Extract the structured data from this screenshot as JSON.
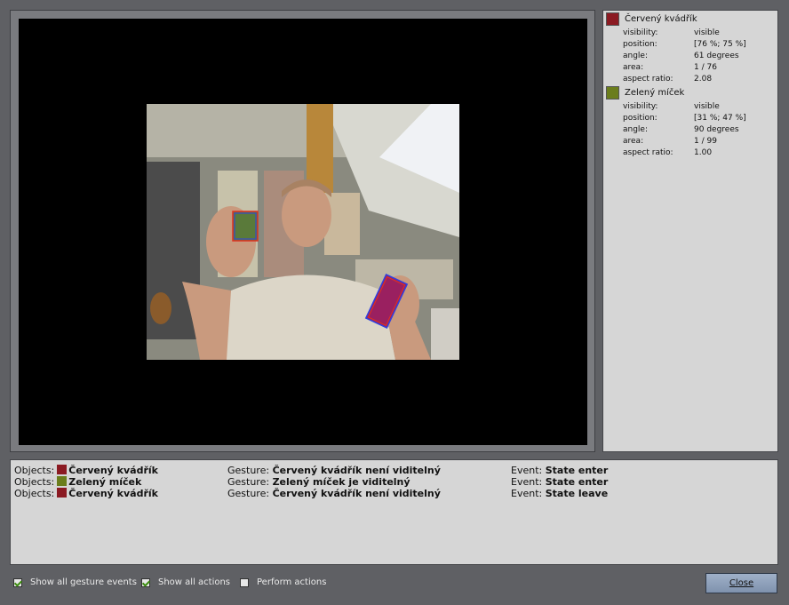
{
  "colors": {
    "red_object": "#8b1a22",
    "green_object": "#6b7d1c"
  },
  "objects": [
    {
      "name": "Červený kvádřík",
      "color": "#8b1a22",
      "props": [
        {
          "key": "visibility:",
          "value": "visible"
        },
        {
          "key": "position:",
          "value": "[76 %; 75 %]"
        },
        {
          "key": "angle:",
          "value": "61 degrees"
        },
        {
          "key": "area:",
          "value": "1 / 76"
        },
        {
          "key": "aspect ratio:",
          "value": "2.08"
        }
      ]
    },
    {
      "name": "Zelený míček",
      "color": "#6b7d1c",
      "props": [
        {
          "key": "visibility:",
          "value": "visible"
        },
        {
          "key": "position:",
          "value": "[31 %; 47 %]"
        },
        {
          "key": "angle:",
          "value": "90 degrees"
        },
        {
          "key": "area:",
          "value": "1 / 99"
        },
        {
          "key": "aspect ratio:",
          "value": "1.00"
        }
      ]
    }
  ],
  "log": {
    "objects_label": "Objects:",
    "gesture_label": "Gesture:",
    "event_label": "Event:",
    "rows": [
      {
        "object": "Červený kvádřík",
        "object_color": "#8b1a22",
        "gesture": "Červený kvádřík není viditelný",
        "event": "State enter"
      },
      {
        "object": "Zelený míček",
        "object_color": "#6b7d1c",
        "gesture": "Zelený míček je viditelný",
        "event": "State enter"
      },
      {
        "object": "Červený kvádřík",
        "object_color": "#8b1a22",
        "gesture": "Červený kvádřík není viditelný",
        "event": "State leave"
      }
    ]
  },
  "options": {
    "show_gesture_events": {
      "label": "Show all gesture events",
      "checked": true
    },
    "show_actions": {
      "label": "Show all actions",
      "checked": true
    },
    "perform_actions": {
      "label": "Perform actions",
      "checked": false
    }
  },
  "close_label": "Close"
}
